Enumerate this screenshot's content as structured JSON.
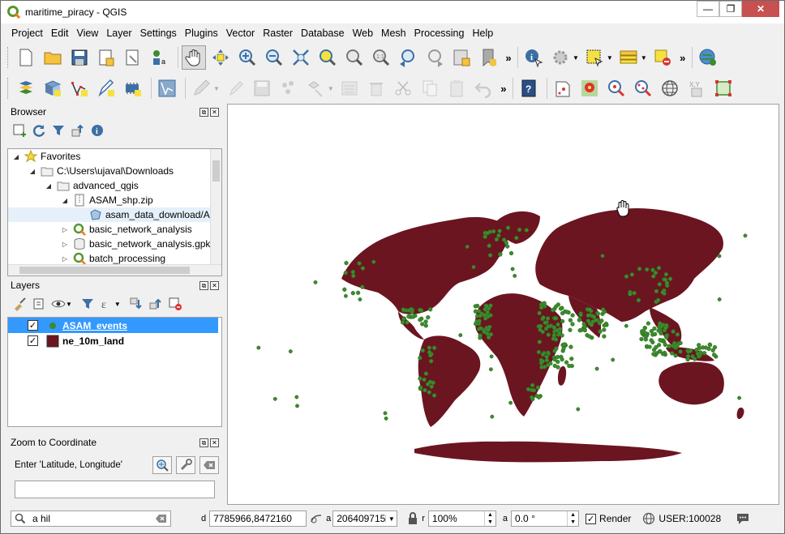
{
  "window": {
    "title": "maritime_piracy - QGIS"
  },
  "menubar": [
    "Project",
    "Edit",
    "View",
    "Layer",
    "Settings",
    "Plugins",
    "Vector",
    "Raster",
    "Database",
    "Web",
    "Mesh",
    "Processing",
    "Help"
  ],
  "browser": {
    "title": "Browser",
    "items": [
      {
        "label": "Favorites",
        "icon": "star-icon",
        "expanded": true
      },
      {
        "label": "C:\\Users\\ujaval\\Downloads",
        "icon": "folder-icon",
        "expanded": true
      },
      {
        "label": "advanced_qgis",
        "icon": "folder-icon",
        "expanded": true
      },
      {
        "label": "ASAM_shp.zip",
        "icon": "zip-icon",
        "expanded": true
      },
      {
        "label": "asam_data_download/A",
        "icon": "polygon-layer-icon",
        "selected": true
      },
      {
        "label": "basic_network_analysis",
        "icon": "qgis-project-icon",
        "expanded": false
      },
      {
        "label": "basic_network_analysis.gpk",
        "icon": "geopackage-icon",
        "expanded": false
      },
      {
        "label": "batch_processing",
        "icon": "qgis-project-icon",
        "expanded": false
      }
    ]
  },
  "layers": {
    "title": "Layers",
    "items": [
      {
        "label": "ASAM_events",
        "checked": true,
        "symbol_color": "#3d8b2e",
        "selected": true
      },
      {
        "label": "ne_10m_land",
        "checked": true,
        "symbol_color": "#6b1520",
        "selected": false
      }
    ]
  },
  "zoom_to_coordinate": {
    "title": "Zoom to Coordinate",
    "label": "Enter 'Latitude, Longitude'",
    "value": ""
  },
  "statusbar": {
    "search_value": "a hil",
    "coordinate": "7785966,8472160",
    "scale": "206409715",
    "magnifier": "100%",
    "rotation": "0.0 °",
    "render_label": "Render",
    "render_checked": true,
    "crs": "USER:100028"
  },
  "map": {
    "land_color": "#6b1520",
    "point_color": "#3d8b2e"
  }
}
